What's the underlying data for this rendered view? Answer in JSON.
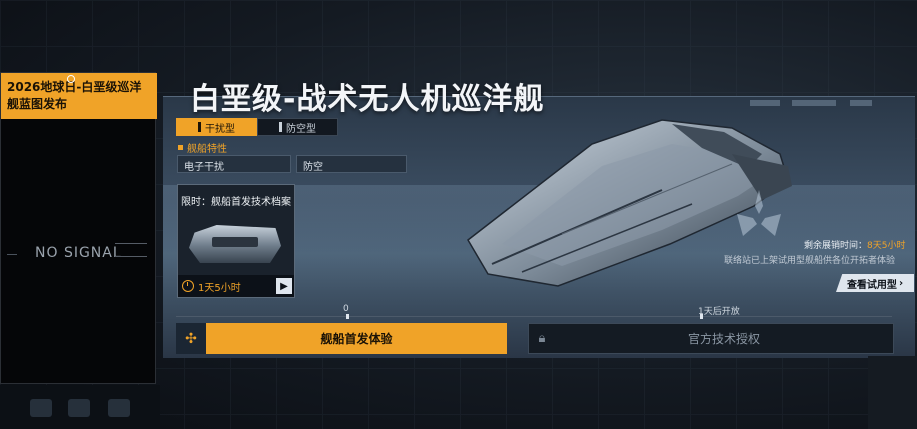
{
  "banner": {
    "title": "2026地球日-白垩级巡洋舰蓝图发布"
  },
  "side_panel": {
    "no_signal": "NO SIGNAL"
  },
  "ship": {
    "name": "白垩级-战术无人机巡洋舰",
    "tabs": [
      {
        "label": "干扰型",
        "active": true
      },
      {
        "label": "防空型",
        "active": false
      }
    ],
    "features_title": "舰船特性",
    "features": [
      "电子干扰",
      "防空"
    ]
  },
  "archive": {
    "label": "限时：舰船首发技术档案",
    "timer": "1天5小时"
  },
  "trial": {
    "remaining_label": "剩余展销时间：",
    "remaining_time": "8天5小时",
    "notice": "联络站已上架试用型舰船供各位开拓者体验",
    "view_button": "查看试用型"
  },
  "timeline": {
    "label_start": "0",
    "label_open": "1天后开放"
  },
  "actions": {
    "first_experience": "舰船首发体验",
    "official_license": "官方技术授权"
  },
  "colors": {
    "accent": "#f0a328",
    "panel": "#2a3848"
  }
}
